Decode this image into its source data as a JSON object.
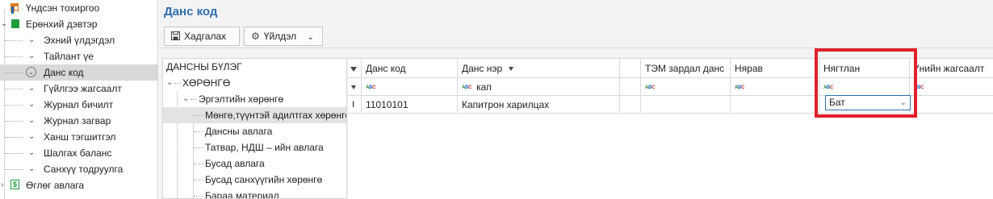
{
  "sidebar": {
    "items": [
      {
        "label": "Үндсэн тохиргоо",
        "icon": "chart-grid-icon"
      },
      {
        "label": "Ерөнхий дэвтэр",
        "icon": "book-icon"
      },
      {
        "label": "Эхний үлдэгдэл"
      },
      {
        "label": "Тайлант үе"
      },
      {
        "label": "Данс код"
      },
      {
        "label": "Гүйлгээ жагсаалт"
      },
      {
        "label": "Журнал бичилт"
      },
      {
        "label": "Журнал загвар"
      },
      {
        "label": "Ханш тэгшитгэл"
      },
      {
        "label": "Шалгах баланс"
      },
      {
        "label": "Санхүү тодруулга"
      },
      {
        "label": "Өглөг авлага",
        "icon": "dollar-icon"
      }
    ]
  },
  "main": {
    "title": "Данс код",
    "toolbar": {
      "save_label": "Хадгалах",
      "action_label": "Үйлдэл"
    }
  },
  "group_tree": {
    "header": "ДАНСНЫ БҮЛЭГ",
    "items": [
      "ХӨРӨНГӨ",
      "Эргэлтийн хөрөнгө",
      "Мөнгө,түүнтэй адилтгах хөрөнгө",
      "Дансны авлага",
      "Татвар, НДШ – ийн авлага",
      "Бусад авлага",
      "Бусад санхүүгийн хөрөнгө",
      "Бараа материал"
    ]
  },
  "grid": {
    "columns": [
      "Данс код",
      "Данс нэр",
      "",
      "ТЭМ зардал данс",
      "Нярав",
      "Нягтлан",
      "Үнийн жагсаалт"
    ],
    "filter": {
      "dans_ner": "кап"
    },
    "rows": [
      {
        "code": "11010101",
        "name": "Капитрон харилцах",
        "accountant": "Бат"
      }
    ]
  },
  "colors": {
    "accent": "#2f6fad",
    "highlight": "#e0202c"
  }
}
